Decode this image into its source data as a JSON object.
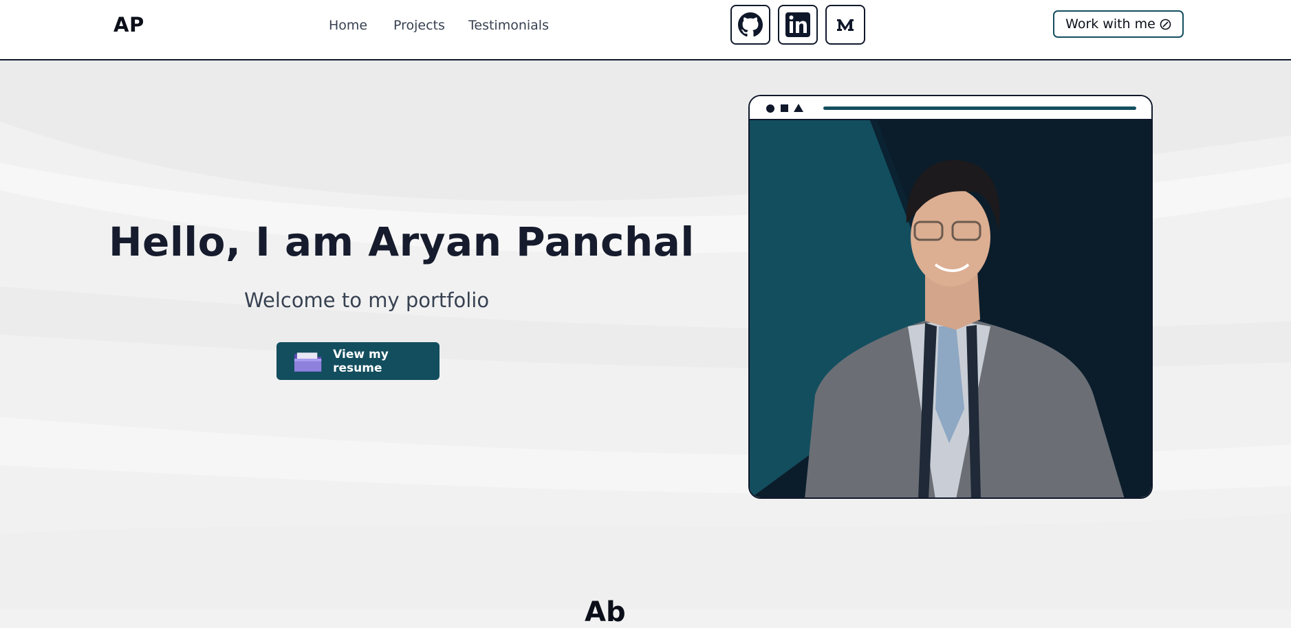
{
  "header": {
    "logo": "AP",
    "nav": [
      {
        "label": "Home"
      },
      {
        "label": "Projects"
      },
      {
        "label": "Testimonials"
      }
    ],
    "socials": [
      {
        "icon": "github-icon"
      },
      {
        "icon": "linkedin-icon"
      },
      {
        "icon": "medium-icon"
      }
    ],
    "cta_label": "Work with me"
  },
  "hero": {
    "title": "Hello, I am Aryan Panchal",
    "subtitle": "Welcome to my portfolio",
    "resume_label": "View my resume"
  },
  "next_section_peek": "Ab",
  "colors": {
    "accent": "#134e5e",
    "dark": "#0f172a",
    "background": "#f2f2f2",
    "photo_bg_left": "#134e5e",
    "photo_bg_right": "#0b1d2b"
  }
}
